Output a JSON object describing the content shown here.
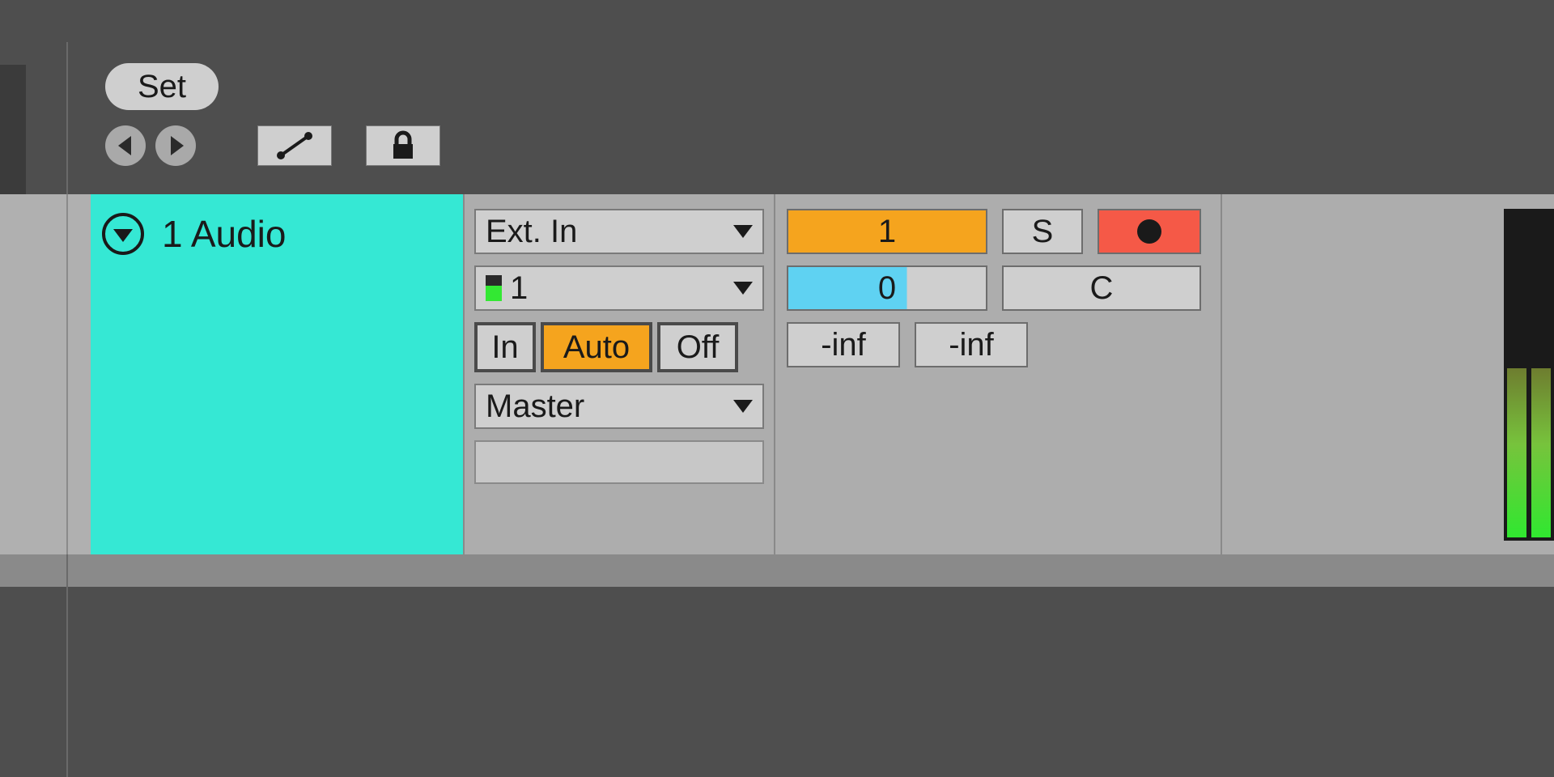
{
  "header": {
    "set_label": "Set"
  },
  "track": {
    "name": "1 Audio",
    "color": "#35e8d4"
  },
  "io": {
    "audio_from_type": "Ext. In",
    "audio_from_channel": "1",
    "monitor": {
      "in": "In",
      "auto": "Auto",
      "off": "Off",
      "selected": "Auto"
    },
    "audio_to": "Master"
  },
  "mixer": {
    "activator": "1",
    "solo": "S",
    "pan": "0",
    "crossfade": "C",
    "send_a": "-inf",
    "send_b": "-inf"
  }
}
